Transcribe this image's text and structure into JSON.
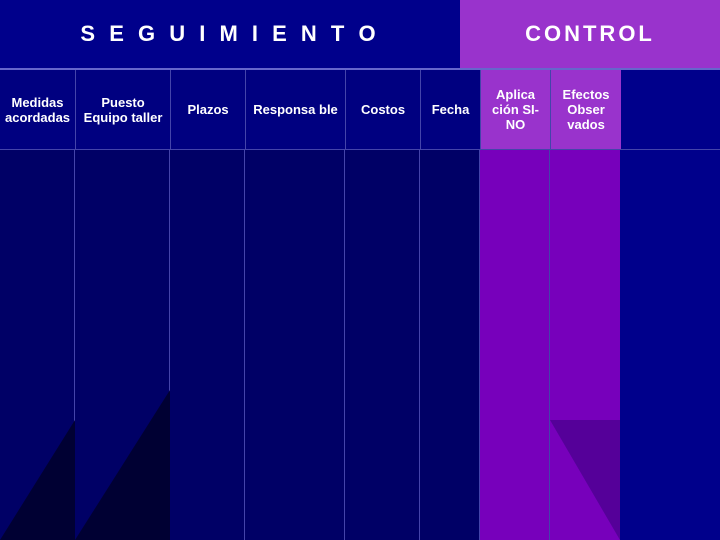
{
  "header": {
    "seguimiento_label": "S E G U I M I E N T O",
    "control_label": "CONTROL"
  },
  "columns": {
    "medidas": "Medidas acordadas",
    "puesto": "Puesto Equipo taller",
    "plazos": "Plazos",
    "responsa": "Responsa ble",
    "costos": "Costos",
    "fecha": "Fecha",
    "aplica": "Aplica ción SI-NO",
    "efectos": "Efectos Obser vados"
  }
}
